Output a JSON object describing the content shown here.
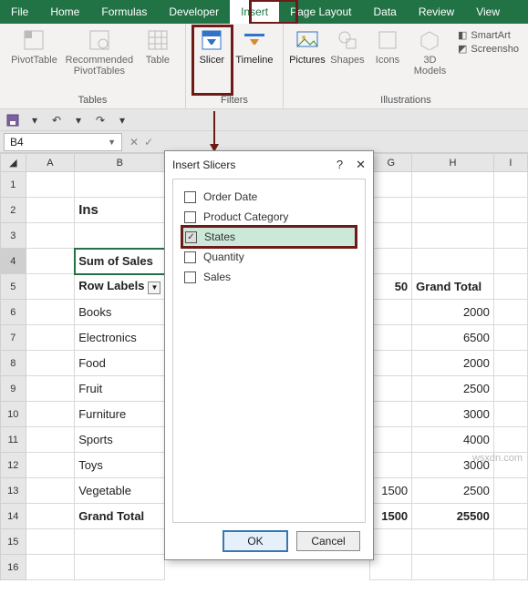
{
  "tabs": [
    "File",
    "Home",
    "Formulas",
    "Developer",
    "Insert",
    "Page Layout",
    "Data",
    "Review",
    "View"
  ],
  "active_tab": "Insert",
  "ribbon": {
    "tables": {
      "label": "Tables",
      "items": [
        "PivotTable",
        "Recommended PivotTables",
        "Table"
      ]
    },
    "filters": {
      "label": "Filters",
      "items": [
        "Slicer",
        "Timeline"
      ]
    },
    "illustrations": {
      "label": "Illustrations",
      "items": [
        "Pictures",
        "Shapes",
        "Icons",
        "3D Models"
      ]
    },
    "side": [
      "SmartArt",
      "Screensho"
    ]
  },
  "qat": {
    "items": [
      "save",
      "undo",
      "redo",
      "dropdown"
    ]
  },
  "namebox": "B4",
  "columns": [
    "A",
    "B",
    "G",
    "H",
    "I"
  ],
  "sheet": {
    "r2b": "Ins",
    "r4b": "Sum of Sales",
    "r5b": "Row Labels",
    "r5g": "50",
    "r5h": "Grand Total",
    "rows": [
      {
        "b": "Books",
        "h": "2000"
      },
      {
        "b": "Electronics",
        "h": "6500"
      },
      {
        "b": "Food",
        "h": "2000"
      },
      {
        "b": "Fruit",
        "h": "2500"
      },
      {
        "b": "Furniture",
        "h": "3000"
      },
      {
        "b": "Sports",
        "h": "4000"
      },
      {
        "b": "Toys",
        "h": "3000"
      },
      {
        "b": "Vegetable",
        "g": "1500",
        "h": "2500"
      }
    ],
    "total": {
      "b": "Grand Total",
      "g": "1500",
      "h": "25500"
    }
  },
  "dialog": {
    "title": "Insert Slicers",
    "fields": [
      "Order Date",
      "Product Category",
      "States",
      "Quantity",
      "Sales"
    ],
    "checked": "States",
    "ok": "OK",
    "cancel": "Cancel"
  },
  "watermark": "wsxdn.com"
}
